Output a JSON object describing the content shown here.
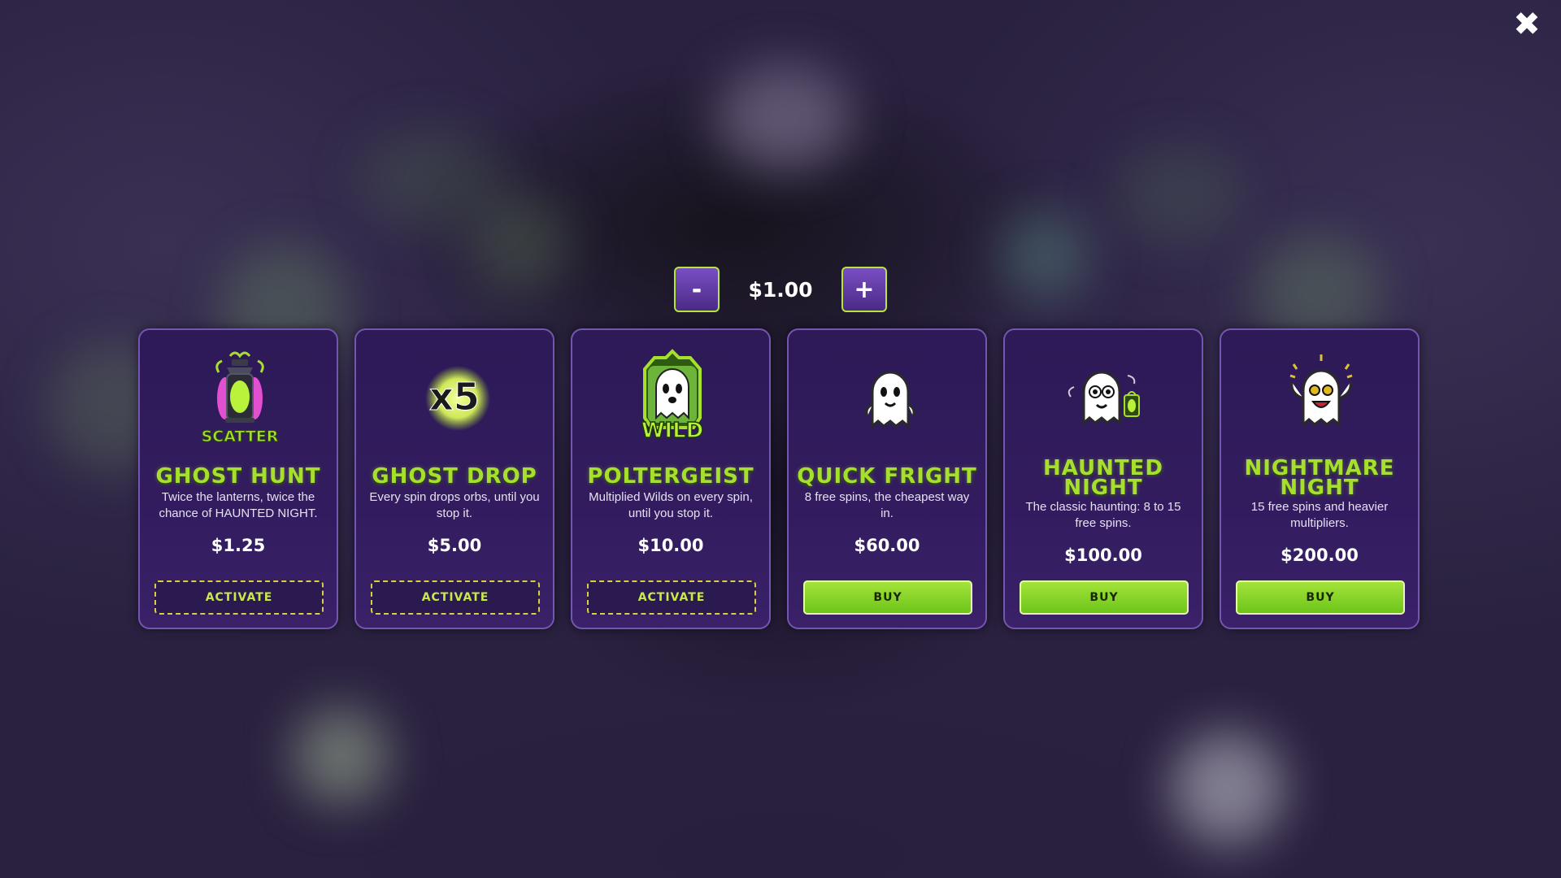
{
  "close_icon": "close-icon",
  "bet": {
    "minus_label": "-",
    "plus_label": "+",
    "value": "$1.00"
  },
  "cards": [
    {
      "title": "GHOST HUNT",
      "description": "Twice the lanterns, twice the chance of HAUNTED NIGHT.",
      "price": "$1.25",
      "button": "ACTIVATE",
      "art_label": "SCATTER",
      "icon": "lantern-scatter-icon"
    },
    {
      "title": "GHOST DROP",
      "description": "Every spin drops orbs, until you stop it.",
      "price": "$5.00",
      "button": "ACTIVATE",
      "art_label": "x5",
      "icon": "x5-orb-icon"
    },
    {
      "title": "POLTERGEIST",
      "description": "Multiplied Wilds on every spin, until you stop it.",
      "price": "$10.00",
      "button": "ACTIVATE",
      "art_label": "WILD",
      "icon": "wild-ghost-icon"
    },
    {
      "title": "QUICK FRIGHT",
      "description": "8 free spins, the cheapest way in.",
      "price": "$60.00",
      "button": "BUY",
      "icon": "ghost-icon"
    },
    {
      "title": "HAUNTED NIGHT",
      "description": "The classic haunting: 8 to 15 free spins.",
      "price": "$100.00",
      "button": "BUY",
      "icon": "ghost-lantern-icon"
    },
    {
      "title": "NIGHTMARE NIGHT",
      "description": "15 free spins and heavier multipliers.",
      "price": "$200.00",
      "button": "BUY",
      "icon": "excited-ghost-icon"
    }
  ],
  "colors": {
    "accent_green": "#a6e02c",
    "card_border": "#7256b0",
    "card_bg": "#2e1a57",
    "activate_border": "#d9cf40"
  }
}
